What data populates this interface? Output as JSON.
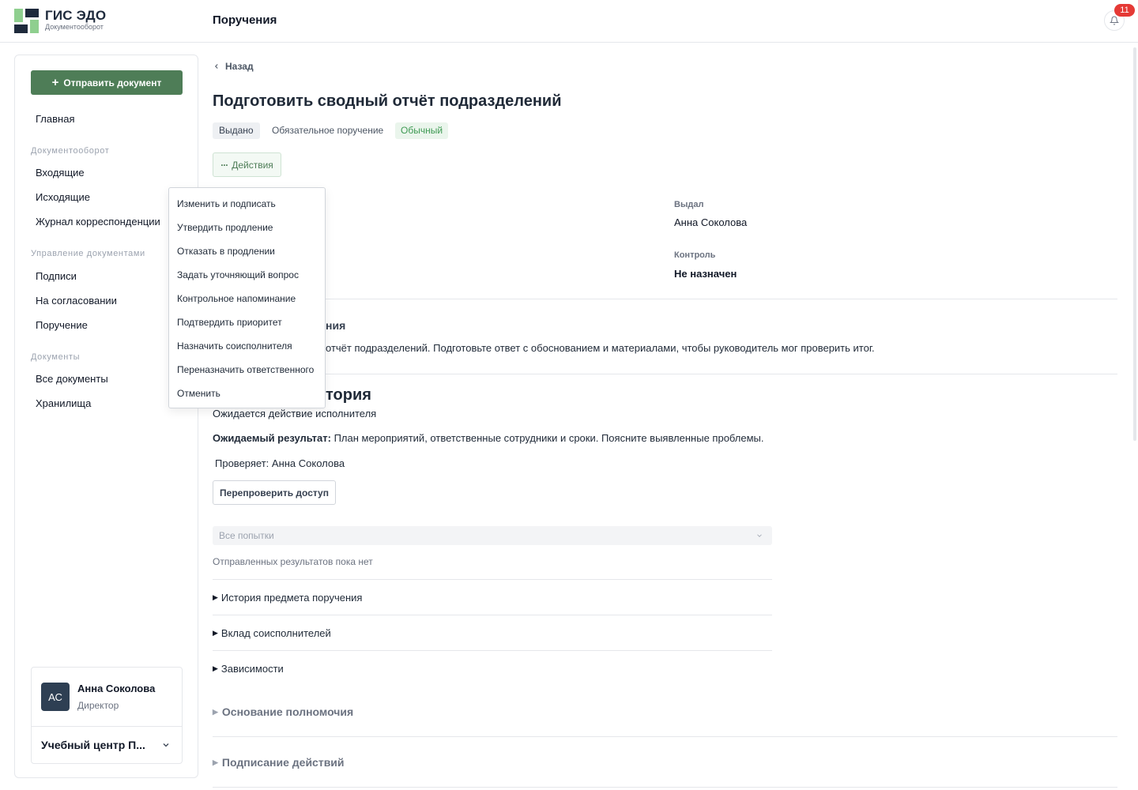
{
  "app": {
    "brand_title": "ГИС ЭДО",
    "brand_subtitle": "Документооборот",
    "page_header": "Поручения",
    "notifications_count": "11",
    "colors": {
      "accent_green": "#4e7d57",
      "logo_dark": "#1e2a3c",
      "logo_green": "#8fcf8f",
      "badge_red": "#e53935"
    }
  },
  "sidebar": {
    "send_button": "Отправить документ",
    "home": "Главная",
    "sections": [
      {
        "title": "Документооборот",
        "items": [
          "Входящие",
          "Исходящие",
          "Журнал корреспонденции"
        ]
      },
      {
        "title": "Управление документами",
        "items": [
          "Подписи",
          "На согласовании",
          "Поручение"
        ]
      },
      {
        "title": "Документы",
        "items": [
          "Все документы",
          "Хранилища"
        ]
      }
    ],
    "profile": {
      "initials": "АС",
      "name": "Анна Соколова",
      "role": "Директор",
      "org": "Учебный центр П..."
    }
  },
  "main": {
    "back_label": "Назад",
    "title": "Подготовить сводный отчёт подразделений",
    "status_badge": "Выдано",
    "type_label": "Обязательное поручение",
    "priority_badge": "Обычный",
    "actions_label": "Действия",
    "fields": {
      "issued_by_label": "Выдал",
      "issued_by_value": "Анна Соколова",
      "control_label": "Контроль",
      "control_value": "Не назначен"
    },
    "description_heading_fragment": "ния",
    "description_text": "отчёт подразделений. Подготовьте ответ с обоснованием и материалами, чтобы руководитель мог проверить итог.",
    "history_heading_fragment": "тория",
    "waiting_text": "Ожидается действие исполнителя",
    "expected_label": "Ожидаемый результат:",
    "expected_text": " План мероприятий, ответственные сотрудники и сроки. Поясните выявленные проблемы.",
    "verifier_text": "Проверяет: Анна Соколова",
    "recheck_button": "Перепроверить доступ",
    "attempts_placeholder": "Все попытки",
    "no_results": "Отправленных результатов пока нет",
    "details": [
      "История предмета поручения",
      "Вклад соисполнителей",
      "Зависимости"
    ],
    "collapsed_sections": [
      "Основание полномочия",
      "Подписание действий"
    ]
  },
  "dropdown": {
    "items": [
      "Изменить и подписать",
      "Утвердить продление",
      "Отказать в продлении",
      "Задать уточняющий вопрос",
      "Контрольное напоминание",
      "Подтвердить приоритет",
      "Назначить соисполнителя",
      "Переназначить ответственного",
      "Отменить"
    ]
  }
}
